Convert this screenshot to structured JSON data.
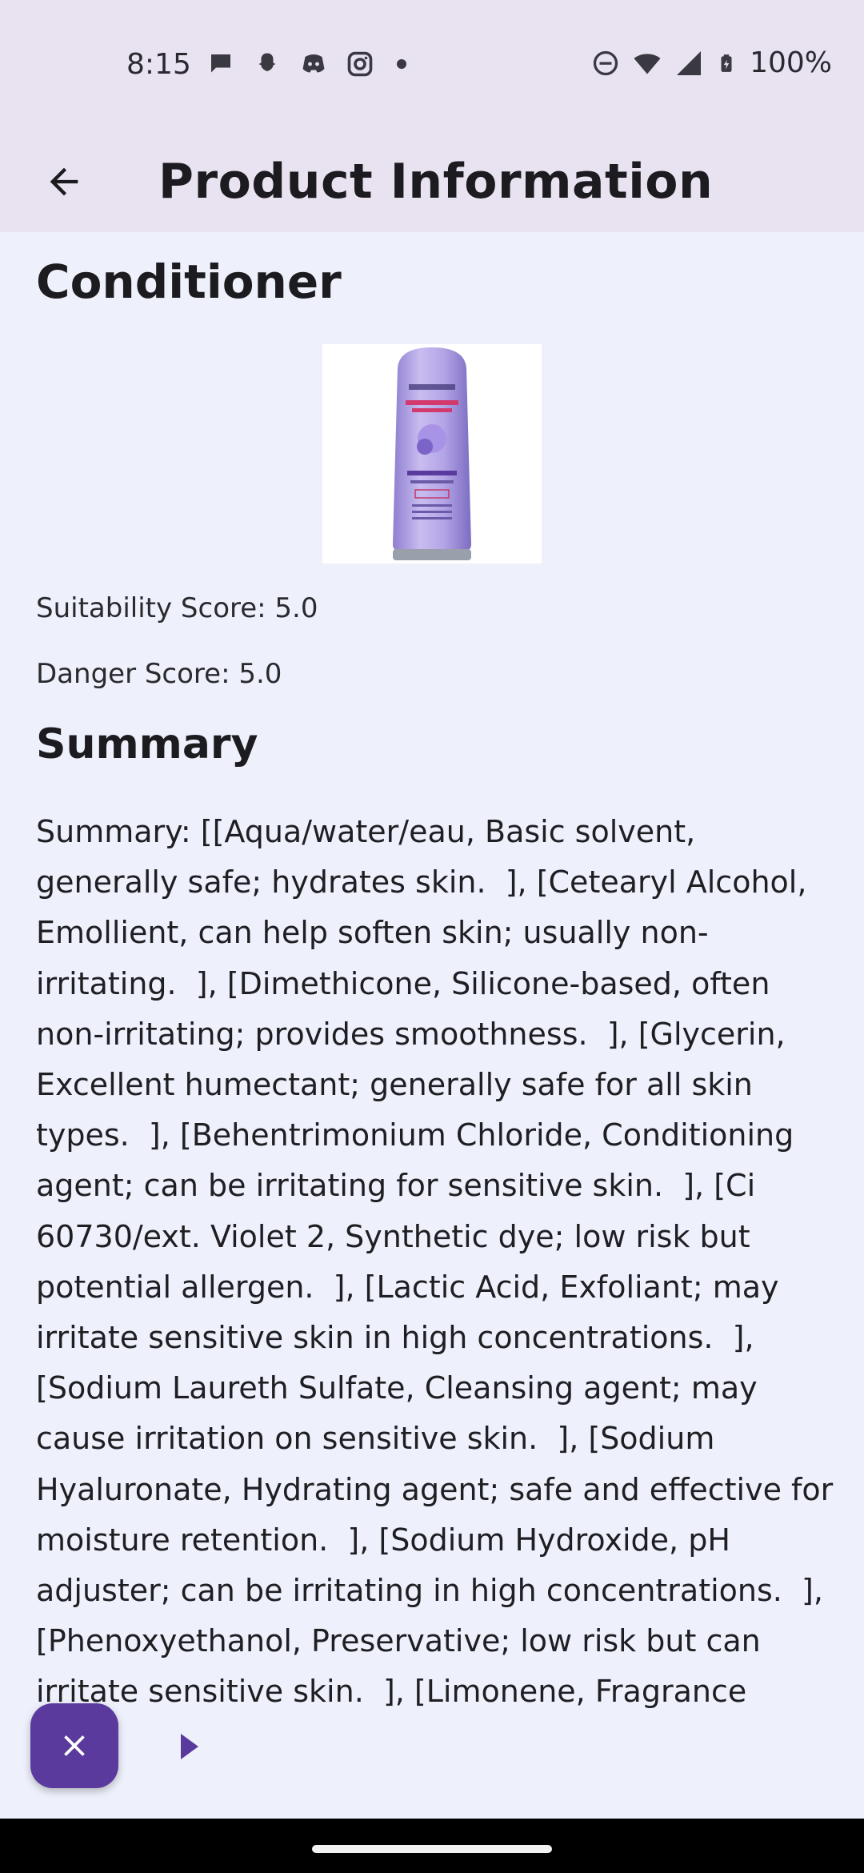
{
  "status_bar": {
    "time": "8:15",
    "battery": "100%",
    "left_icons": [
      "chat-icon",
      "snapchat-icon",
      "discord-icon",
      "instagram-icon",
      "dot-icon"
    ],
    "right_icons": [
      "dnd-icon",
      "wifi-icon",
      "signal-icon",
      "battery-icon"
    ]
  },
  "app_bar": {
    "title": "Product Information",
    "back_icon": "arrow-back-icon"
  },
  "product": {
    "name": "Conditioner",
    "image_icon": "conditioner-bottle-image",
    "suitability": "Suitability Score: 5.0",
    "danger": "Danger Score: 5.0"
  },
  "summary": {
    "heading": "Summary",
    "text": "Summary: [[Aqua/water/eau, Basic solvent, generally safe; hydrates skin.  ], [Cetearyl Alcohol, Emollient, can help soften skin; usually non-irritating.  ], [Dimethicone, Silicone-based, often non-irritating; provides smoothness.  ], [Glycerin, Excellent humectant; generally safe for all skin types.  ], [Behentrimonium Chloride, Conditioning agent; can be irritating for sensitive skin.  ], [Ci 60730/ext. Violet 2, Synthetic dye; low risk but potential allergen.  ], [Lactic Acid, Exfoliant; may irritate sensitive skin in high concentrations.  ], [Sodium Laureth Sulfate, Cleansing agent; may cause irritation on sensitive skin.  ], [Sodium Hyaluronate, Hydrating agent; safe and effective for moisture retention.  ], [Sodium Hydroxide, pH adjuster; can be irritating in high concentrations.  ], [Phenoxyethanol, Preservative; low risk but can irritate sensitive skin.  ], [Limonene, Fragrance"
  },
  "fab": {
    "icon": "close-icon",
    "color": "#5b3a9e"
  },
  "colors": {
    "background": "#eef1fb",
    "app_bar": "#e9e3f1",
    "accent": "#5b3a9e"
  }
}
